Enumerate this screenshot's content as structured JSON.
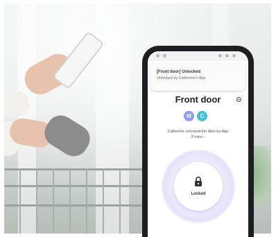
{
  "notification": {
    "title": "[Front door] Unlocked",
    "body": "Unlocked by Catherine's App"
  },
  "device": {
    "name": "Front door"
  },
  "users": [
    {
      "initial": "M",
      "color": "#8f9df0"
    },
    {
      "initial": "C",
      "color": "#45bfd8"
    }
  ],
  "activity": {
    "message": "Catherine unlocked the door by App",
    "time": "2 mins"
  },
  "lock": {
    "status": "Locked"
  },
  "icons": {
    "settings": "gear-icon",
    "lock": "padlock-icon"
  },
  "colors": {
    "accent": "#8f7fe6",
    "phone_frame": "#1e1e22"
  }
}
